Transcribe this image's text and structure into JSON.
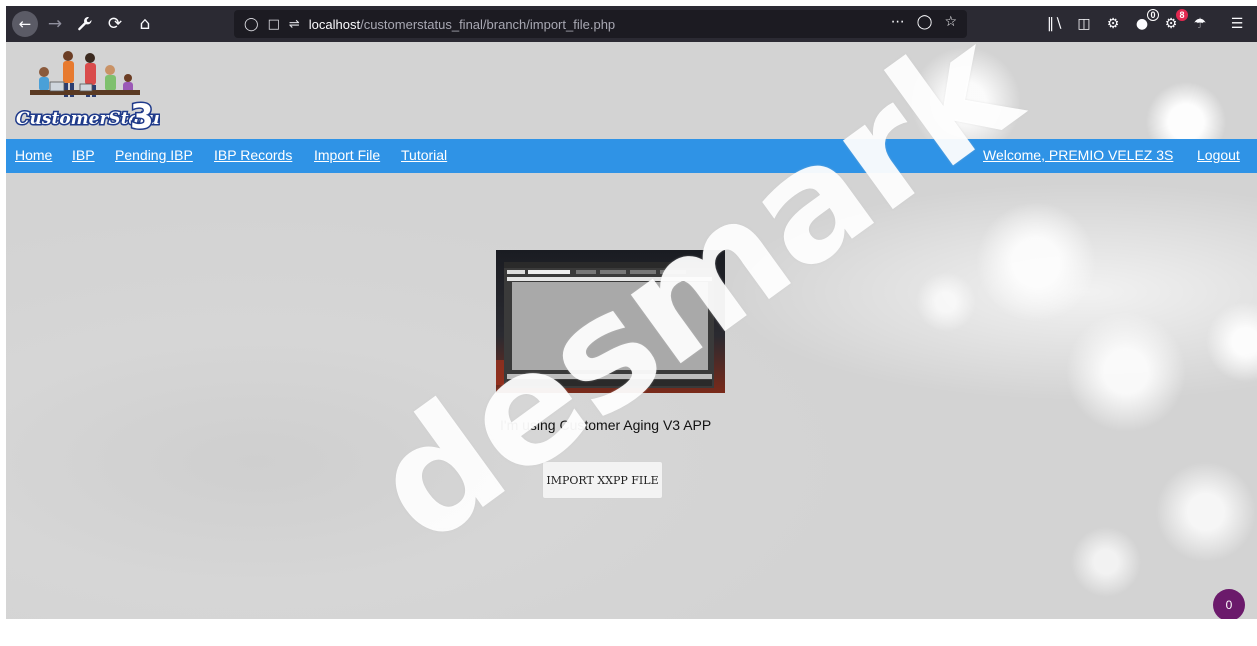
{
  "browser": {
    "url_host": "localhost",
    "url_path": "/customerstatus_final/branch/import_file.php",
    "badge_1": "0",
    "badge_2": "8"
  },
  "logo": {
    "text": "CustomerStatus",
    "version": "3"
  },
  "nav": {
    "links": [
      {
        "label": "Home"
      },
      {
        "label": "IBP"
      },
      {
        "label": "Pending IBP"
      },
      {
        "label": "IBP Records"
      },
      {
        "label": "Import File"
      },
      {
        "label": "Tutorial"
      }
    ],
    "welcome": "Welcome, PREMIO VELEZ 3S",
    "logout": "Logout"
  },
  "main": {
    "caption": "I'm using Customer Aging V3 APP",
    "import_button": "IMPORT XXPP FILE"
  },
  "watermark": "desmark",
  "chat": {
    "count": "0"
  },
  "colors": {
    "navbar": "#2f93e6",
    "browser_toolbar": "#2b2a33",
    "chat_bubble": "#6b1a6b"
  }
}
